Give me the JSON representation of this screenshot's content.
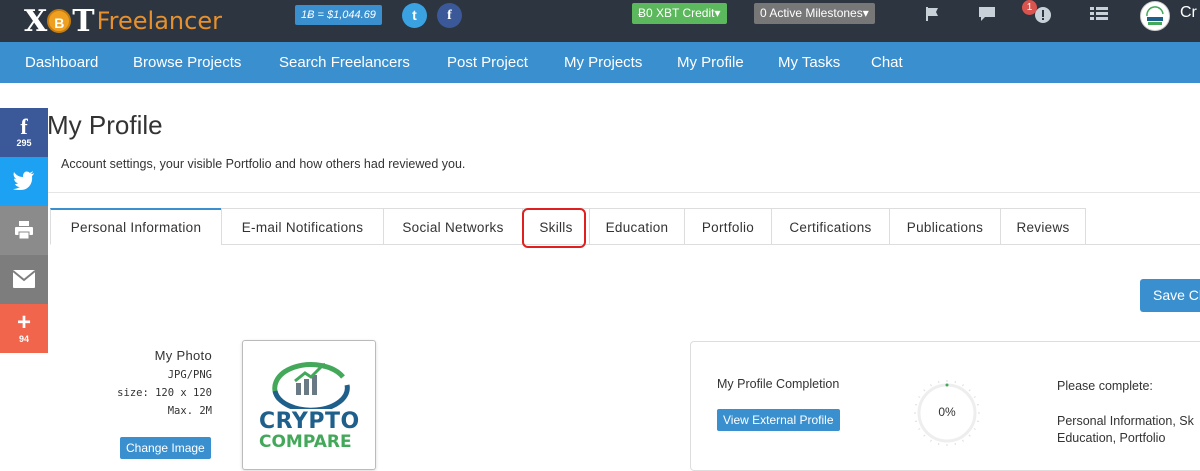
{
  "topbar": {
    "logo_x": "X",
    "logo_coin": "B",
    "logo_t": "T",
    "logo_free": "Freelancer",
    "price": "1Ƀ = $1,044.69",
    "twitter_icon": "t",
    "facebook_icon": "f",
    "credit": "Ƀ0 XBT Credit▾",
    "milestones": "0 Active Milestones▾",
    "notif_count": "1",
    "user_name": "Cr"
  },
  "nav": {
    "items": [
      "Dashboard",
      "Browse Projects",
      "Search Freelancers",
      "Post Project",
      "My Projects",
      "My Profile",
      "My Tasks",
      "Chat"
    ]
  },
  "share": {
    "facebook_count": "295",
    "plus_count": "94"
  },
  "page": {
    "title": "My Profile",
    "subtitle": "Account settings, your visible Portfolio and how others had reviewed you."
  },
  "tabs": [
    "Personal Information",
    "E-mail Notifications",
    "Social Networks",
    "Skills",
    "Education",
    "Portfolio",
    "Certifications",
    "Publications",
    "Reviews"
  ],
  "save_label": "Save Ch",
  "photo": {
    "label": "My Photo",
    "format": "JPG/PNG",
    "size": "size: 120 x 120",
    "max": "Max. 2M",
    "change_label": "Change Image",
    "logo_line1": "CRYPTO",
    "logo_line2": "COMPARE"
  },
  "completion": {
    "title": "My Profile Completion",
    "external_label": "View External Profile",
    "value": "0%",
    "percent": 0,
    "please": "Please complete:",
    "items": "Personal Information, Sk Education, Portfolio"
  }
}
